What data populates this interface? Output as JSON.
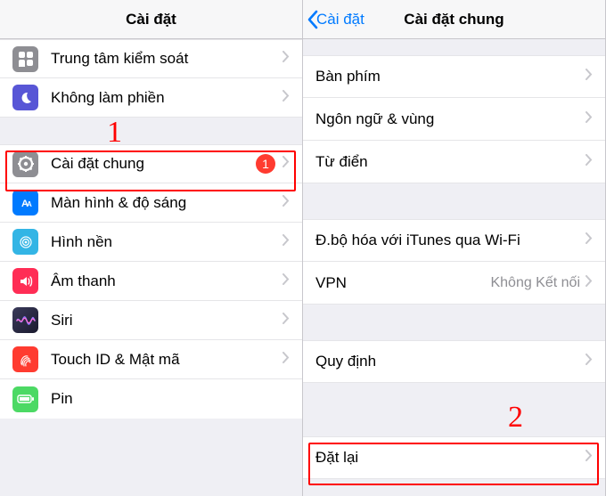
{
  "annotations": {
    "step1": "1",
    "step2": "2"
  },
  "left": {
    "title": "Cài đặt",
    "rows": {
      "control_center": "Trung tâm kiểm soát",
      "dnd": "Không làm phiền",
      "general": "Cài đặt chung",
      "general_badge": "1",
      "display": "Màn hình & độ sáng",
      "wallpaper": "Hình nền",
      "sounds": "Âm thanh",
      "siri": "Siri",
      "touchid": "Touch ID & Mật mã",
      "pin": "Pin"
    }
  },
  "right": {
    "back": "Cài đặt",
    "title": "Cài đặt chung",
    "rows": {
      "keyboard": "Bàn phím",
      "language": "Ngôn ngữ & vùng",
      "dictionary": "Từ điển",
      "itunes_wifi": "Đ.bộ hóa với iTunes qua Wi-Fi",
      "vpn": "VPN",
      "vpn_status": "Không Kết nối",
      "regulatory": "Quy định",
      "reset": "Đặt lại"
    }
  }
}
